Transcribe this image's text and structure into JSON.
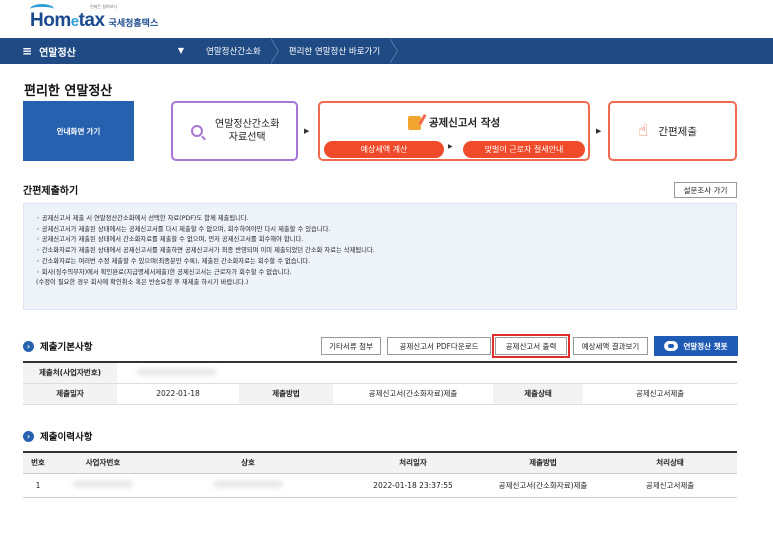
{
  "brand": {
    "name_home": "Hom",
    "name_e": "e",
    "name_tax": "tax",
    "subtitle": "국세청홈택스",
    "tagline": "언제든 살펴보다"
  },
  "nav": {
    "menu_label": "연말정산",
    "breadcrumbs": [
      "연말정산간소화",
      "편리한 연말정산 바로가기"
    ]
  },
  "page_title": "편리한 연말정산",
  "steps": {
    "guide_button": "안내화면 가기",
    "step1_line1": "연말정산간소화",
    "step1_line2": "자료선택",
    "step2_title": "공제신고서 작성",
    "step2_pill1": "예상세액 계산",
    "step2_pill2": "맞벌이 근로자 절세안내",
    "step3_title": "간편제출"
  },
  "section": {
    "title": "간편제출하기",
    "survey_button": "설문조사 가기"
  },
  "notice": [
    "◦ 공제신고서 제출 시 연말정산간소화에서 선택한 자료(PDF)도 함께 제출됩니다.",
    "◦ 공제신고서가 제출된 상태에서는 공제신고서를 다시 제출할 수 없으며, 회수하여야만 다시 제출할 수 있습니다.",
    "◦ 공제신고서가 제출된 상태에서 간소화자료를 제출할 수 없으며, 먼저 공제신고서를 회수해야 합니다.",
    "◦ 간소화자료가 제출된 상태에서 공제신고서를 제출하면 공제신고서가 최종 반영되며 이미 제출되었던 간소화 자료는 삭제됩니다.",
    "◦ 간소화자료는 여러번 수정 제출할 수 있으며(최종분만 수록), 제출된 간소화자료는 회수할 수 없습니다.",
    "◦ 회사(징수의무자)에서 확인완료(지급명세서제출)한 공제신고서는 근로자가 회수할 수 없습니다.",
    "  (수정이 필요한 경우 회사에 확인취소 혹은 반송요청 후 재제출 하시기 바랍니다.)"
  ],
  "basic": {
    "title": "제출기본사항",
    "buttons": [
      "기타서류 첨부",
      "공제신고서 PDF다운로드",
      "공제신고서 출력",
      "예상세액 결과보기"
    ],
    "chatbot": "연말정산 챗봇",
    "row1_label": "제출처(사업자번호)",
    "row2": {
      "label_date": "제출일자",
      "date": "2022-01-18",
      "label_method": "제출방법",
      "method": "공제신고서(간소화자료)제출",
      "label_status": "제출상태",
      "status": "공제신고서제출"
    }
  },
  "history": {
    "title": "제출이력사항",
    "headers": [
      "번호",
      "사업자번호",
      "상호",
      "처리일자",
      "제출방법",
      "처리상태"
    ],
    "rows": [
      {
        "no": "1",
        "date": "2022-01-18 23:37:55",
        "method": "공제신고서(간소화자료)제출",
        "status": "공제신고서제출"
      }
    ]
  }
}
